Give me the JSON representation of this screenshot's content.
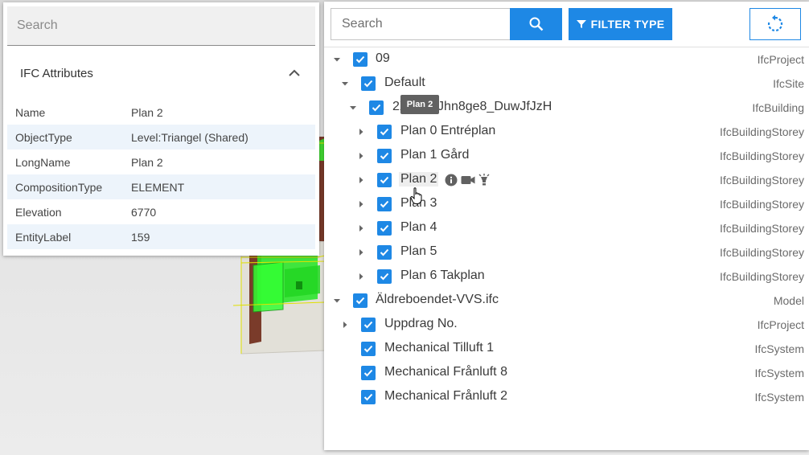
{
  "attributes_panel": {
    "search_placeholder": "Search",
    "title": "IFC Attributes",
    "rows": [
      {
        "key": "Name",
        "value": "Plan 2"
      },
      {
        "key": "ObjectType",
        "value": "Level:Triangel (Shared)"
      },
      {
        "key": "LongName",
        "value": "Plan 2"
      },
      {
        "key": "CompositionType",
        "value": "ELEMENT"
      },
      {
        "key": "Elevation",
        "value": "6770"
      },
      {
        "key": "EntityLabel",
        "value": "159"
      }
    ]
  },
  "tree_panel": {
    "search_placeholder": "Search",
    "filter_label": "FILTER TYPE",
    "tooltip": "Plan 2",
    "rows": [
      {
        "label": "09",
        "type": "IfcProject",
        "expanded": true
      },
      {
        "label": "Default",
        "type": "IfcSite",
        "expanded": true
      },
      {
        "label": "2XBJepJhn8ge8_DuwJfJzH",
        "type": "IfcBuilding",
        "expanded": true
      },
      {
        "label": "Plan 0 Entréplan",
        "type": "IfcBuildingStorey",
        "expanded": false
      },
      {
        "label": "Plan 1 Gård",
        "type": "IfcBuildingStorey",
        "expanded": false
      },
      {
        "label": "Plan 2",
        "type": "IfcBuildingStorey",
        "expanded": false
      },
      {
        "label": "Plan 3",
        "type": "IfcBuildingStorey",
        "expanded": false
      },
      {
        "label": "Plan 4",
        "type": "IfcBuildingStorey",
        "expanded": false
      },
      {
        "label": "Plan 5",
        "type": "IfcBuildingStorey",
        "expanded": false
      },
      {
        "label": "Plan 6 Takplan",
        "type": "IfcBuildingStorey",
        "expanded": false
      },
      {
        "label": "Äldreboendet-VVS.ifc",
        "type": "Model",
        "expanded": true
      },
      {
        "label": "Uppdrag No.",
        "type": "IfcProject",
        "expanded": false
      },
      {
        "label": "Mechanical Tilluft 1",
        "type": "IfcSystem"
      },
      {
        "label": "Mechanical Frånluft 8",
        "type": "IfcSystem"
      },
      {
        "label": "Mechanical Frånluft 2",
        "type": "IfcSystem"
      }
    ]
  },
  "colors": {
    "accent": "#1e88e5",
    "model_green": "#22e022",
    "row_alt": "#edf4fb"
  },
  "icons": [
    "search-icon",
    "filter-icon",
    "reset-view-icon",
    "chevron-up-icon",
    "caret-down-icon",
    "caret-right-icon",
    "checkbox-checked-icon",
    "info-icon",
    "camera-icon",
    "lightbulb-icon",
    "hand-cursor-icon"
  ]
}
